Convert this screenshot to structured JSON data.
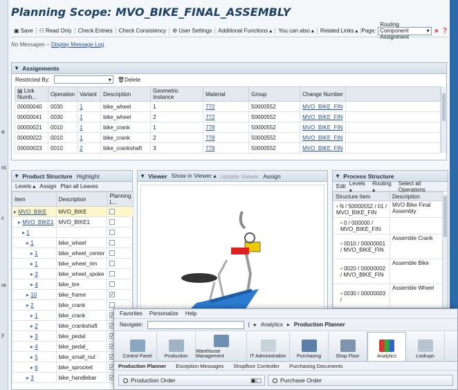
{
  "left_strip": [
    "a",
    "nt",
    "c",
    "re",
    "y"
  ],
  "title": "Planning Scope: MVO_BIKE_FINAL_ASSEMBLY",
  "toolbar": {
    "items": [
      "Save",
      "Read Only",
      "Check Entries",
      "Check Consistency",
      "User Settings",
      "Additional Functions",
      "You can also",
      "Related Links"
    ],
    "page_label": "Page:",
    "page_value": "Routing Component Assignment"
  },
  "messages": {
    "text": "No Messages",
    "link": "Display Message Log"
  },
  "assignments": {
    "title": "Assignments",
    "restricted_by": "Restricted By:",
    "delete": "Delete",
    "columns": [
      "Link Numb...",
      "Operation",
      "Variant",
      "Description",
      "Geometric Instance",
      "Material",
      "Group",
      "Change Number"
    ],
    "rows": [
      [
        "00000040",
        "0030",
        "1",
        "bike_wheel",
        "1",
        "772",
        "50000552",
        "MVO_BIKE_FIN"
      ],
      [
        "00000041",
        "0030",
        "1",
        "bike_wheel",
        "2",
        "772",
        "50000552",
        "MVO_BIKE_FIN"
      ],
      [
        "00000021",
        "0010",
        "1",
        "bike_crank",
        "1",
        "778",
        "50000552",
        "MVO_BIKE_FIN"
      ],
      [
        "00000022",
        "0010",
        "1",
        "bike_crank",
        "2",
        "778",
        "50000552",
        "MVO_BIKE_FIN"
      ],
      [
        "00000023",
        "0010",
        "2",
        "bike_crankshaft",
        "3",
        "779",
        "50000552",
        "MVO_BIKE_FIN"
      ]
    ]
  },
  "product_structure": {
    "title": "Product Structure",
    "highlight": "Highlight",
    "tools": [
      "Levels",
      "Assign",
      "Plan all Leaves"
    ],
    "columns": [
      "Item",
      "Description",
      "Planning L..."
    ],
    "rows": [
      {
        "item": "MVO_BIKE",
        "desc": "MVO_BIKE",
        "checked": false
      },
      {
        "item": "MVO_BIKE1",
        "desc": "MVO_BIKE1",
        "checked": false
      },
      {
        "item": "1",
        "desc": "",
        "checked": false
      },
      {
        "item": "1",
        "desc": "bike_wheel",
        "checked": false
      },
      {
        "item": "1",
        "desc": "bike_wheel_center",
        "checked": false
      },
      {
        "item": "1",
        "desc": "bike_wheel_rim",
        "checked": false
      },
      {
        "item": "3",
        "desc": "bike_wheel_spoke",
        "checked": false
      },
      {
        "item": "4",
        "desc": "bike_tire",
        "checked": false
      },
      {
        "item": "10",
        "desc": "bike_frame",
        "checked": true
      },
      {
        "item": "2",
        "desc": "bike_crank",
        "checked": false
      },
      {
        "item": "1",
        "desc": "bike_crank",
        "checked": true
      },
      {
        "item": "2",
        "desc": "bike_crankshaft",
        "checked": true
      },
      {
        "item": "3",
        "desc": "bike_pedal",
        "checked": true
      },
      {
        "item": "4",
        "desc": "bike_pedal_",
        "checked": true
      },
      {
        "item": "5",
        "desc": "bike_small_nut",
        "checked": true
      },
      {
        "item": "6",
        "desc": "bike_sprocket",
        "checked": true
      },
      {
        "item": "3",
        "desc": "bike_handlebar",
        "checked": true
      }
    ]
  },
  "viewer": {
    "title": "Viewer",
    "tools": [
      "Show in Viewer",
      "Update Viewer",
      "Assign"
    ]
  },
  "process_structure": {
    "title": "Process Structure",
    "tools": [
      "Edit",
      "Levels",
      "Routing",
      "Select all Operations"
    ],
    "columns": [
      "Structure Item",
      "Description"
    ],
    "rows": [
      {
        "item": "N / 50000552 / 01 / MVO_BIKE_FIN",
        "desc": "MVO Bike Final Assembly"
      },
      {
        "item": "0 / 000000 / MVO_BIKE_FIN",
        "desc": ""
      },
      {
        "item": "0010 / 00000001 / MVO_BIKE_FIN",
        "desc": "Assemble Crank"
      },
      {
        "item": "0020 / 00000002 / MVO_BIKE_FIN",
        "desc": "Assemble Bike"
      },
      {
        "item": "0030 / 00000003 /",
        "desc": "Assemble Wheel"
      }
    ]
  },
  "overlay": {
    "menu": [
      "Favorites",
      "Personalize",
      "Help"
    ],
    "navigate_label": "Navigate:",
    "breadcrumb": [
      "Analytics",
      "Production Planner"
    ],
    "buttons": [
      "Control Panel",
      "Production",
      "Warehouse Management",
      "IT Administration",
      "Purchasing",
      "Shop Floor",
      "Analytics",
      "Lookups"
    ],
    "active_button": "Analytics",
    "tabs": [
      "Production Planner",
      "Exception Messages",
      "Shopfloor Controller",
      "Purchasing Documents"
    ],
    "panes": [
      "Production Order",
      "Purchase Order"
    ]
  }
}
